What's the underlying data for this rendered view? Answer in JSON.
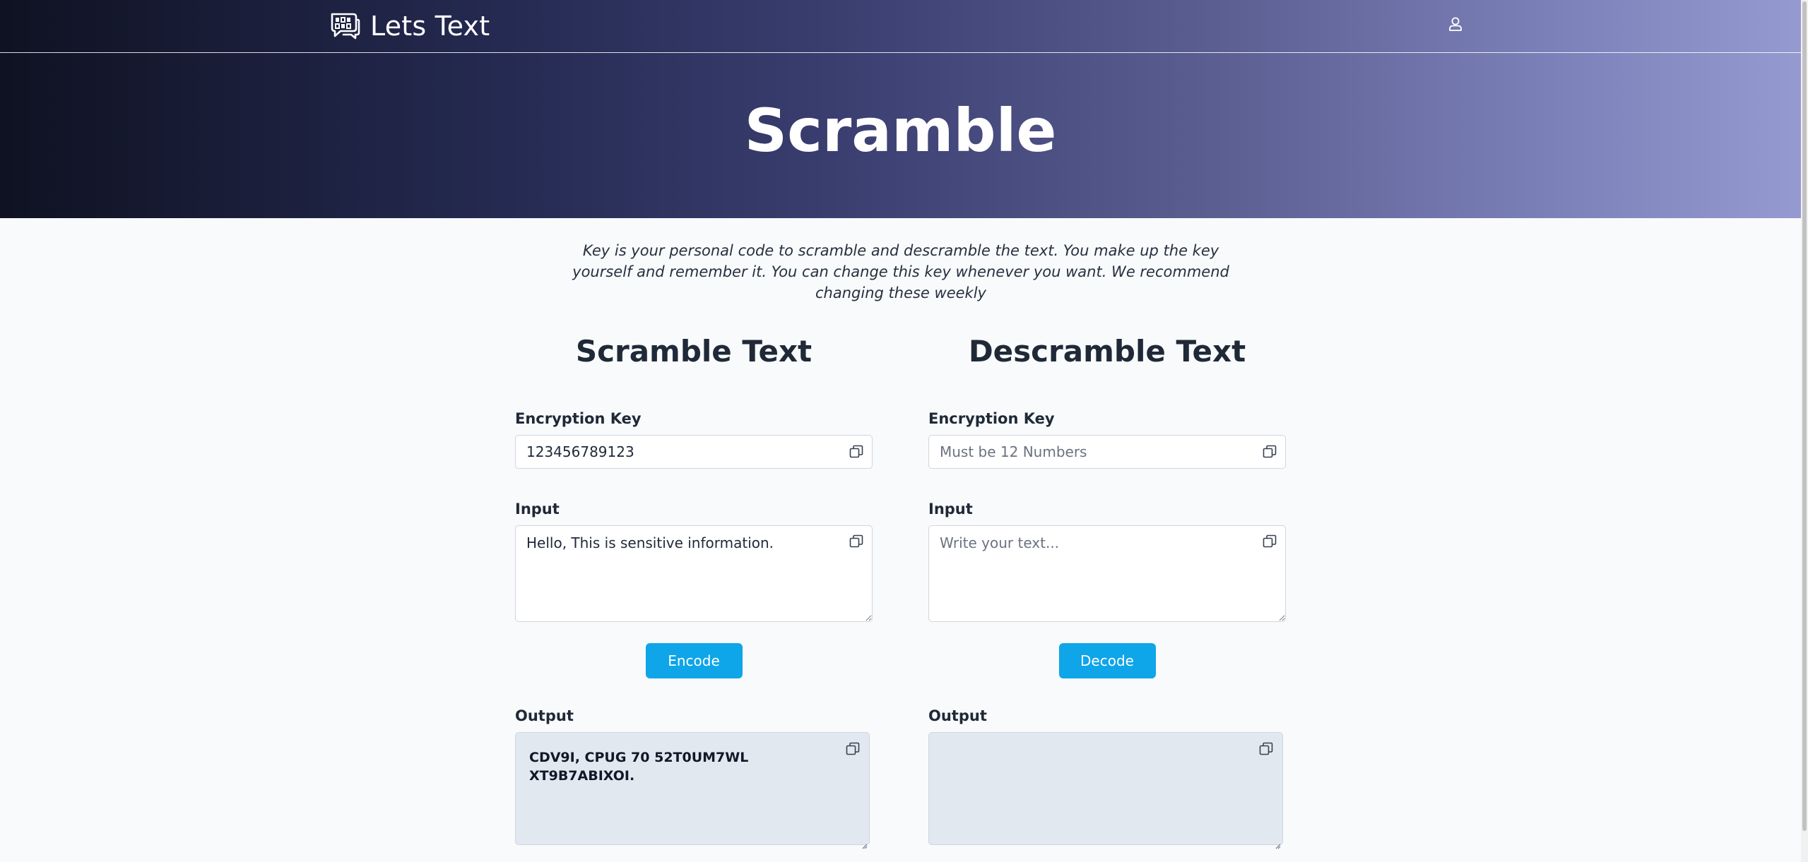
{
  "header": {
    "brand_name": "Lets Text",
    "logo_icon": "chat-bubbles-logo-icon",
    "user_icon": "user-icon"
  },
  "hero": {
    "title": "Scramble",
    "gradient": [
      "#0f1222",
      "#252a52",
      "#3c4072",
      "#5c5f92",
      "#7b80b8",
      "#959ad0"
    ]
  },
  "intro_text": "Key is your personal code to scramble and descramble the text. You make up the key yourself and remember it. You can change this key whenever you want. We recommend changing these weekly",
  "scramble": {
    "title": "Scramble Text",
    "key_label": "Encryption Key",
    "key_value": "123456789123",
    "key_placeholder": "Must be 12 Numbers",
    "input_label": "Input",
    "input_value": "Hello, This is sensitive information.",
    "input_placeholder": "Write your text...",
    "button_label": "Encode",
    "output_label": "Output",
    "output_value": "CDV9I, CPUG 70 52T0UM7WL XT9B7ABIXOI."
  },
  "descramble": {
    "title": "Descramble Text",
    "key_label": "Encryption Key",
    "key_value": "",
    "key_placeholder": "Must be 12 Numbers",
    "input_label": "Input",
    "input_value": "",
    "input_placeholder": "Write your text...",
    "button_label": "Decode",
    "output_label": "Output",
    "output_value": ""
  },
  "colors": {
    "accent_button": "#0ea5e9",
    "page_background": "#f8fafc",
    "output_background": "#e2e8f0"
  }
}
